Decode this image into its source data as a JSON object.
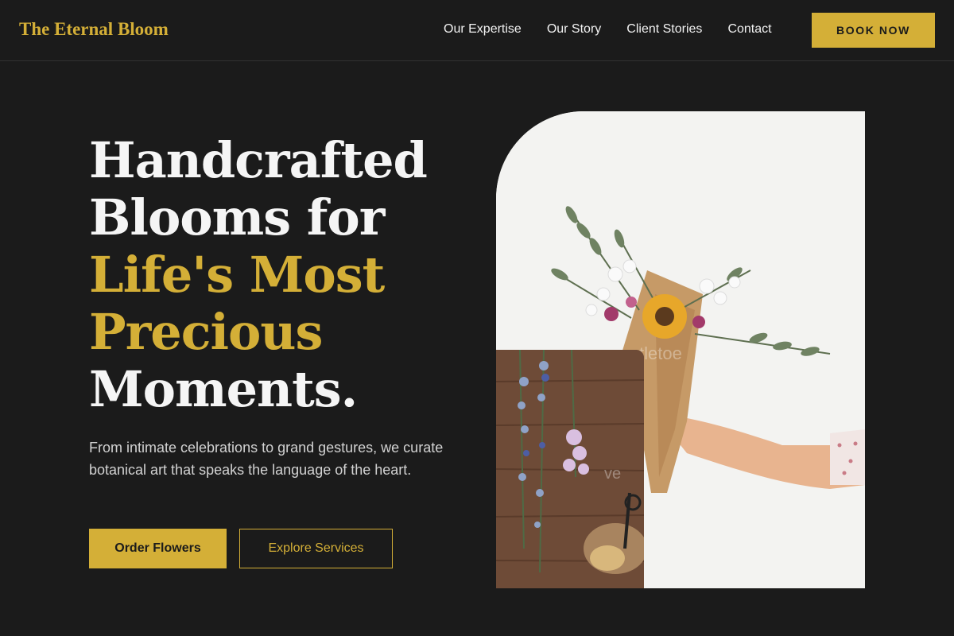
{
  "brand": {
    "name": "The Eternal Bloom"
  },
  "nav": {
    "items": [
      "Our Expertise",
      "Our Story",
      "Client Stories",
      "Contact"
    ],
    "cta": "BOOK NOW"
  },
  "hero": {
    "headline": {
      "line1": "Handcrafted",
      "line2": "Blooms for",
      "line3": "Life's Most",
      "line4": "Precious",
      "line5": "Moments."
    },
    "lead": "From intimate celebrations to grand gestures, we curate botanical art that speaks the language of the heart.",
    "primary_button": "Order Flowers",
    "secondary_button": "Explore Services"
  },
  "images": {
    "main": {
      "watermark": "tletoe"
    },
    "inset": {
      "watermark": "ve"
    }
  },
  "colors": {
    "background": "#1b1b1b",
    "accent": "#d4af37",
    "text": "#f2f2f2"
  }
}
